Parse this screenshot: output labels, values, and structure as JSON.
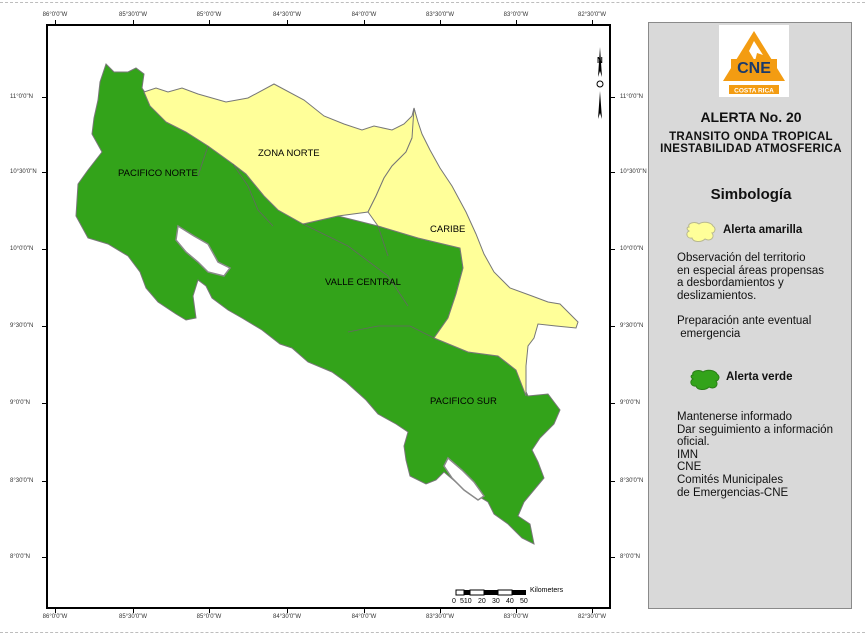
{
  "map": {
    "lon_ticks": [
      "86°0'0\"W",
      "85°30'0\"W",
      "85°0'0\"W",
      "84°30'0\"W",
      "84°0'0\"W",
      "83°30'0\"W",
      "83°0'0\"W",
      "82°30'0\"W"
    ],
    "lat_ticks": [
      "11°0'0\"N",
      "10°30'0\"N",
      "10°0'0\"N",
      "9°30'0\"N",
      "9°0'0\"N",
      "8°30'0\"N",
      "8°0'0\"N"
    ],
    "regions": [
      {
        "name": "ZONA NORTE",
        "alert": "amarilla"
      },
      {
        "name": "PACIFICO NORTE",
        "alert": "verde"
      },
      {
        "name": "CARIBE",
        "alert": "amarilla"
      },
      {
        "name": "VALLE CENTRAL",
        "alert": "verde"
      },
      {
        "name": "PACIFICO SUR",
        "alert": "verde"
      }
    ],
    "scale_bar": {
      "unit": "Kilometers",
      "labels": [
        "0",
        "510",
        "20",
        "30",
        "40",
        "50"
      ]
    },
    "north_arrow": {
      "letter": "N"
    }
  },
  "colors": {
    "yellow_alert": "#ffff99",
    "green_alert": "#33a31a",
    "panel": "#d9d9d9",
    "logo_orange": "#f39c12",
    "logo_blue": "#1a3a6b"
  },
  "legend": {
    "logo_text": "CNE",
    "logo_subtext": "COSTA RICA",
    "alert_title": "ALERTA No. 20",
    "event_line1": "TRANSITO ONDA TROPICAL",
    "event_line2": "INESTABILIDAD ATMOSFERICA",
    "symbology_title": "Simbología",
    "yellow_label": "Alerta amarilla",
    "yellow_lines": [
      "Observación del territorio",
      "en especial áreas propensas",
      "a desbordamientos y",
      "deslizamientos.",
      "",
      "Preparación ante eventual",
      " emergencia"
    ],
    "green_label": "Alerta verde",
    "green_lines": [
      "Mantenerse informado",
      "Dar seguimiento a información",
      "oficial.",
      "IMN",
      "CNE",
      "Comités Municipales",
      "de Emergencias-CNE"
    ]
  }
}
